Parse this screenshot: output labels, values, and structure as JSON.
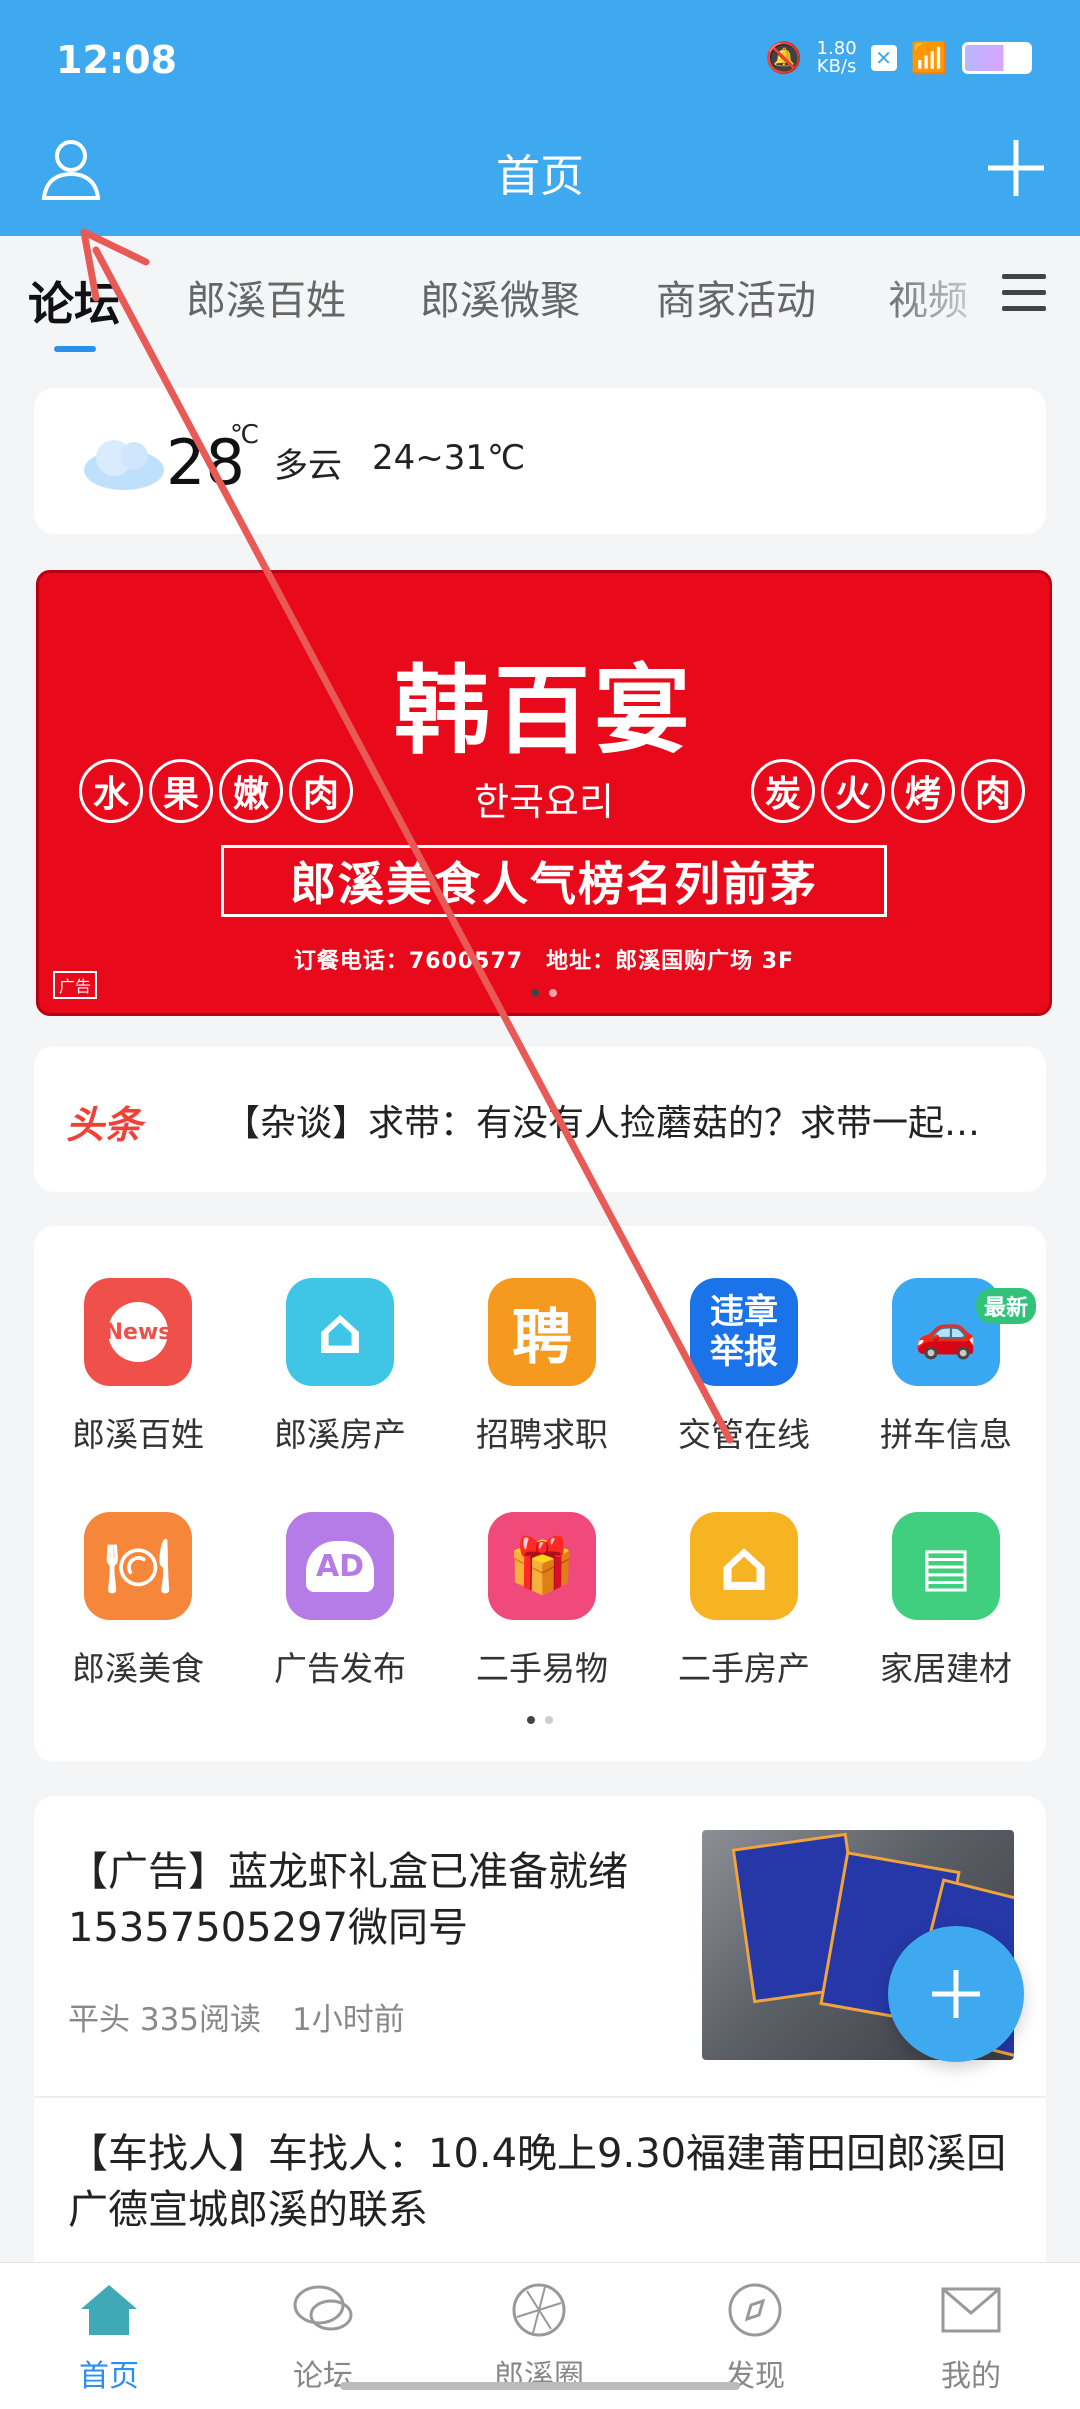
{
  "status_bar": {
    "time": "12:08",
    "speed": "1.80\nKB/s"
  },
  "header": {
    "title": "首页"
  },
  "tabs": [
    {
      "label": "论坛",
      "active": true
    },
    {
      "label": "郎溪百姓"
    },
    {
      "label": "郎溪微聚"
    },
    {
      "label": "商家活动"
    },
    {
      "label": "视频"
    }
  ],
  "weather": {
    "temp": "28",
    "unit": "℃",
    "desc": "多云",
    "range": "24~31℃"
  },
  "banner": {
    "logo": "韩百宴",
    "korean": "한국요리",
    "left_words": [
      "水",
      "果",
      "嫩",
      "肉"
    ],
    "right_words": [
      "炭",
      "火",
      "烤",
      "肉"
    ],
    "slogan": "郎溪美食人气榜名列前茅",
    "contact": "订餐电话：7600577　地址：郎溪国购广场 3F",
    "ad_tag": "广告"
  },
  "headline": {
    "badge": "头条",
    "text": "【杂谈】求带：有没有人捡蘑菇的？求带一起…"
  },
  "grid": {
    "row1": [
      {
        "label": "郎溪百姓",
        "color": "#f0504a",
        "glyph": "News"
      },
      {
        "label": "郎溪房产",
        "color": "#3fc5e6",
        "glyph": "⌂"
      },
      {
        "label": "招聘求职",
        "color": "#f59a1e",
        "glyph": "聘"
      },
      {
        "label": "交管在线",
        "color": "#1a73e8",
        "glyph": "违章\n举报"
      },
      {
        "label": "拼车信息",
        "color": "#3aa7f2",
        "glyph": "🚗",
        "badge": "最新"
      }
    ],
    "row2": [
      {
        "label": "郎溪美食",
        "color": "#f5863a",
        "glyph": "🍽"
      },
      {
        "label": "广告发布",
        "color": "#b57be6",
        "glyph": "AD"
      },
      {
        "label": "二手易物",
        "color": "#f04a7a",
        "glyph": "🎁"
      },
      {
        "label": "二手房产",
        "color": "#f7b422",
        "glyph": "⌂"
      },
      {
        "label": "家居建材",
        "color": "#3fcf7e",
        "glyph": "▤"
      }
    ]
  },
  "feed": [
    {
      "title": "【广告】蓝龙虾礼盒已准备就绪15357505297微同号",
      "meta": "平头 335阅读　1小时前"
    },
    {
      "title": "【车找人】车找人：10.4晚上9.30福建莆田回郎溪回广德宣城郎溪的联系"
    }
  ],
  "bottom_nav": [
    {
      "label": "首页",
      "active": true
    },
    {
      "label": "论坛"
    },
    {
      "label": "郎溪圈"
    },
    {
      "label": "发现"
    },
    {
      "label": "我的"
    }
  ]
}
